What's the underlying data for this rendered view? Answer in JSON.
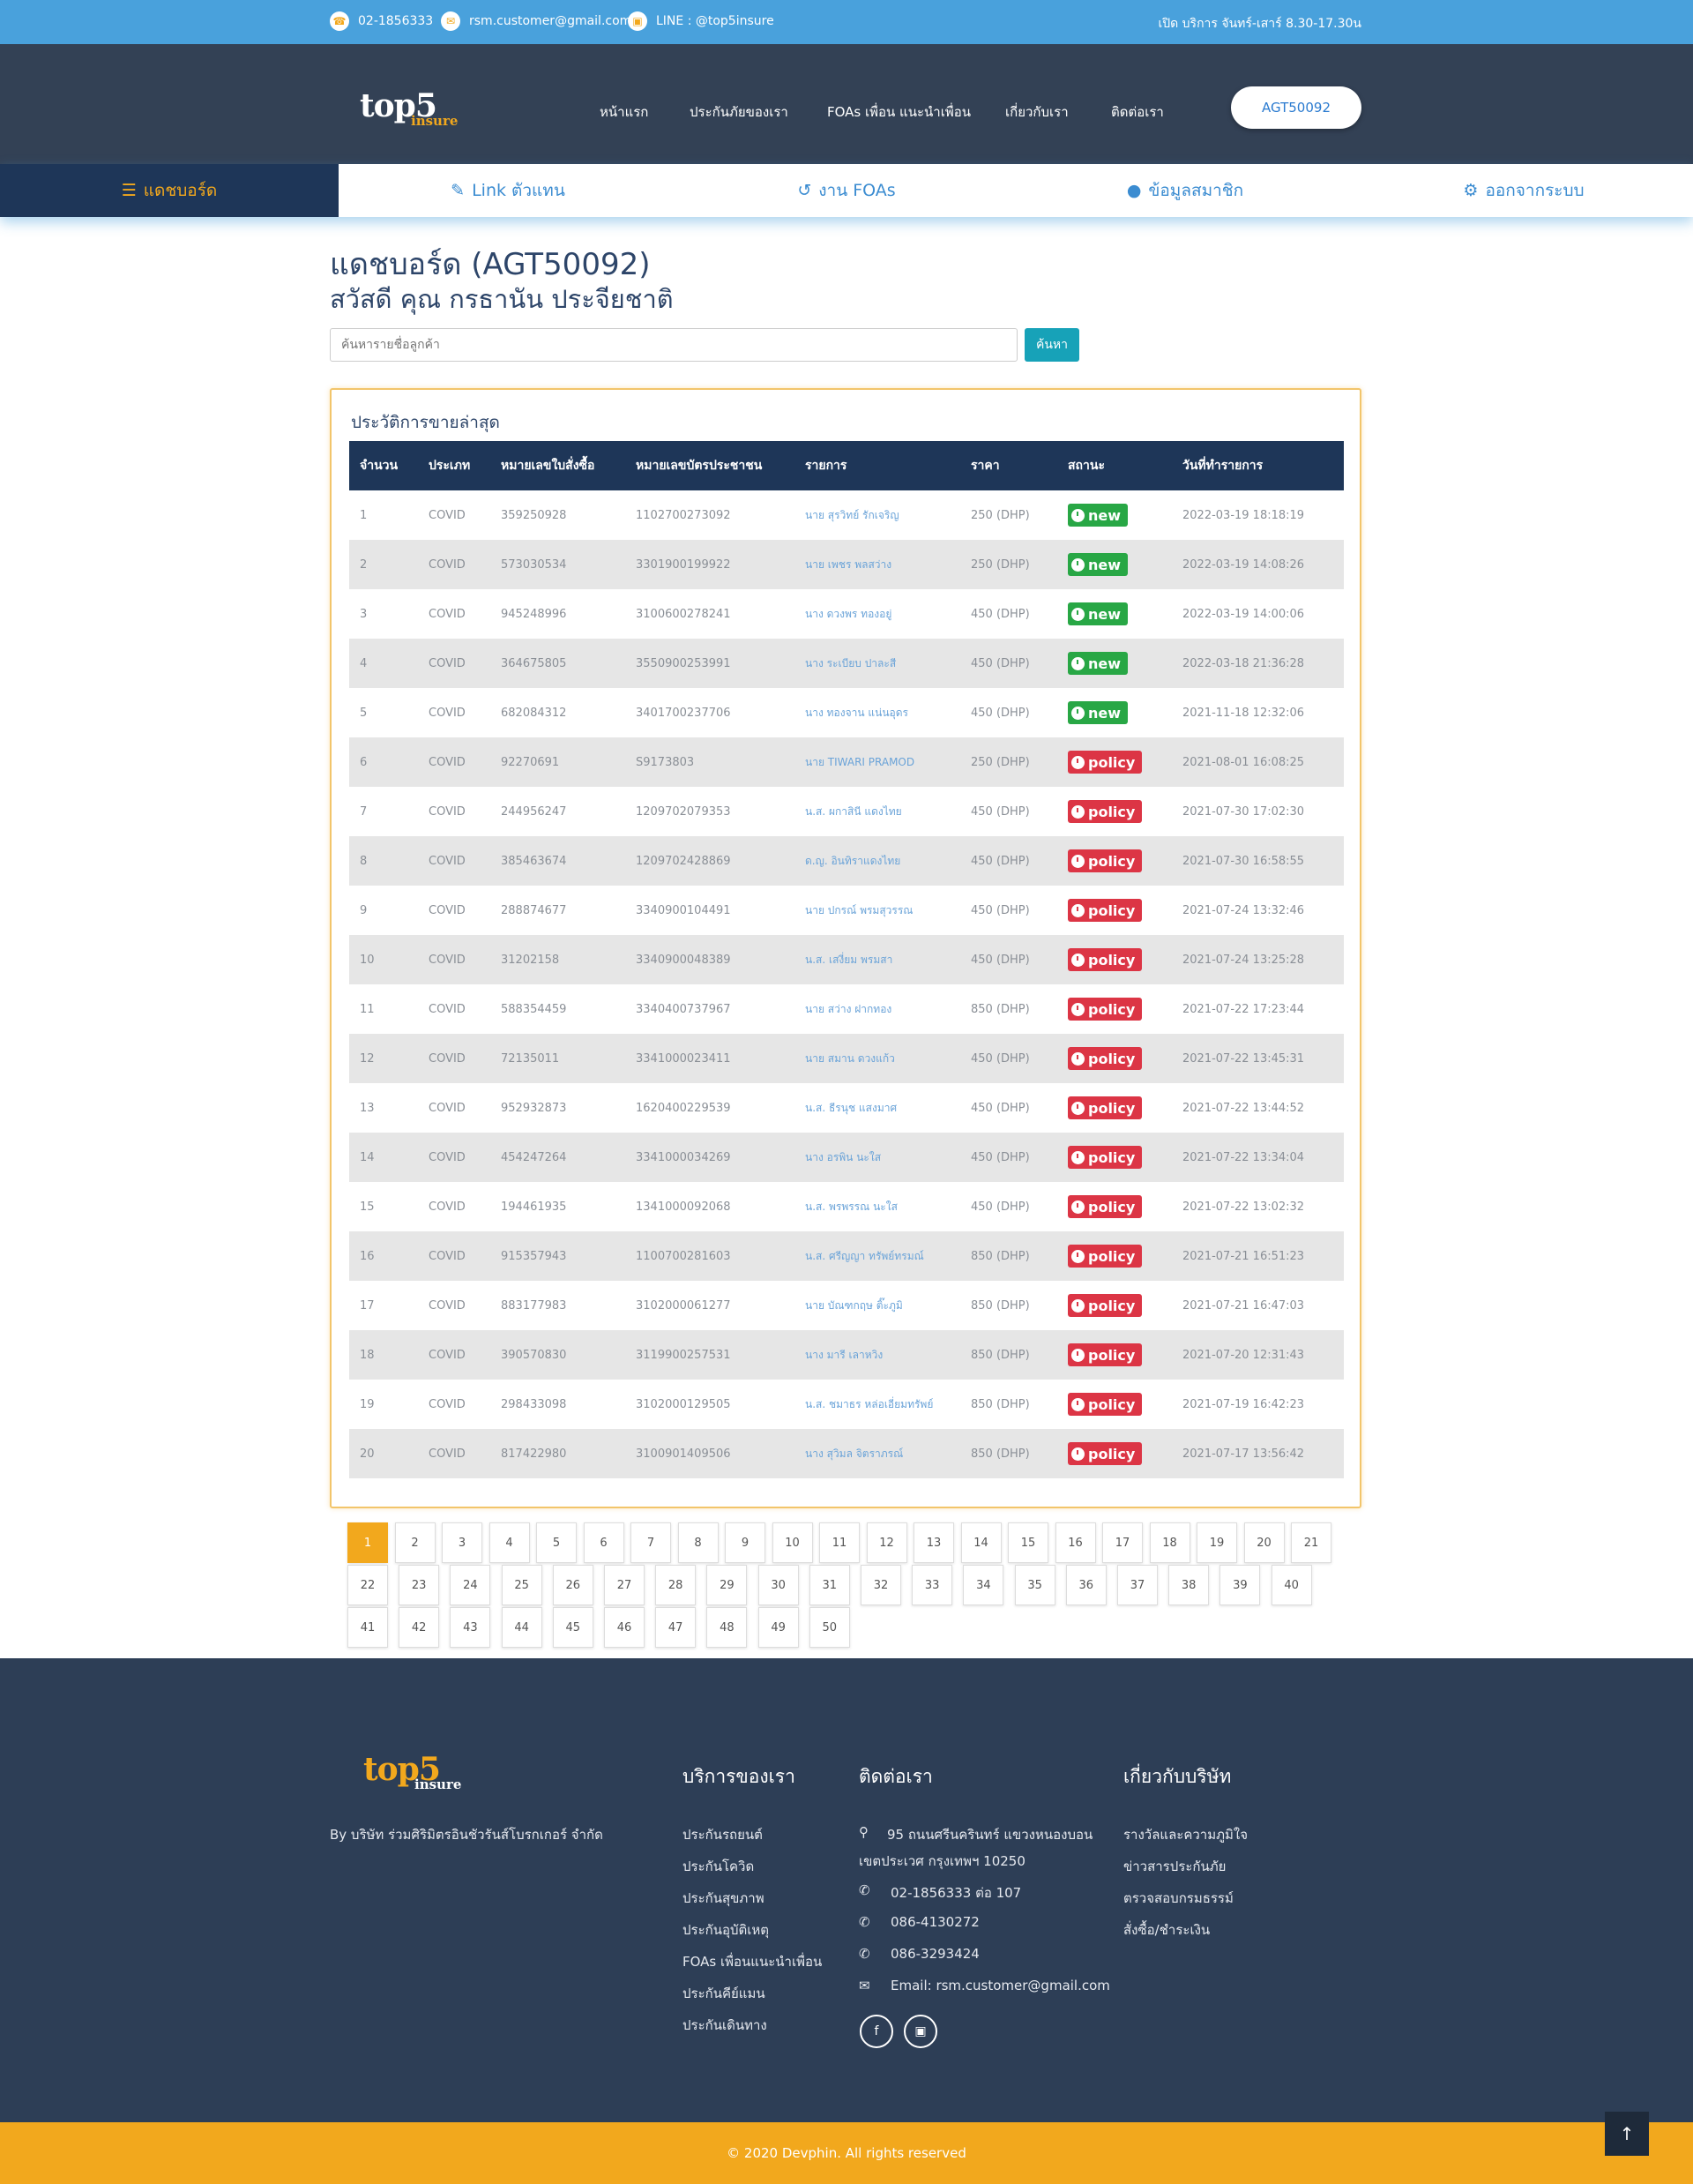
{
  "topbar": {
    "phone": "02-1856333",
    "email": "rsm.customer@gmail.com",
    "line": "LINE : @top5insure",
    "hours": "เปิด บริการ จันทร์-เสาร์ 8.30-17.30น"
  },
  "logo": {
    "text": "top5",
    "sub": "insure"
  },
  "nav": [
    "หน้าแรก",
    "ประกันภัยของเรา",
    "FOAs เพื่อน แนะนำเพื่อน",
    "เกี่ยวกับเรา",
    "ติดต่อเรา"
  ],
  "agent_button": "AGT50092",
  "tabs": [
    {
      "label": "แดชบอร์ด",
      "icon": "list-icon"
    },
    {
      "label": "Link ตัวแทน",
      "icon": "edit-icon"
    },
    {
      "label": "งาน FOAs",
      "icon": "history-icon"
    },
    {
      "label": "ข้อมูลสมาชิก",
      "icon": "user-icon"
    },
    {
      "label": "ออกจากระบบ",
      "icon": "gear-icon"
    }
  ],
  "page": {
    "title": "แดชบอร์ด (AGT50092)",
    "greeting": "สวัสดี คุณ กรธานัน ประจียชาติ",
    "search_placeholder": "ค้นหารายชื่อลูกค้า",
    "search_button": "ค้นหา"
  },
  "sales": {
    "title": "ประวัติการขายล่าสุด",
    "columns": [
      "จำนวน",
      "ประเภท",
      "หมายเลขใบสั่งซื้อ",
      "หมายเลขบัตรประชาชน",
      "รายการ",
      "ราคา",
      "สถานะ",
      "วันที่ทำรายการ"
    ],
    "rows": [
      [
        "1",
        "COVID",
        "359250928",
        "1102700273092",
        "นาย สุรวิทย์ รักเจริญ",
        "250 (DHP)",
        "new",
        "2022-03-19 18:18:19"
      ],
      [
        "2",
        "COVID",
        "573030534",
        "3301900199922",
        "นาย เพชร พลสว่าง",
        "250 (DHP)",
        "new",
        "2022-03-19 14:08:26"
      ],
      [
        "3",
        "COVID",
        "945248996",
        "3100600278241",
        "นาง ดวงพร ทองอยู่",
        "450 (DHP)",
        "new",
        "2022-03-19 14:00:06"
      ],
      [
        "4",
        "COVID",
        "364675805",
        "3550900253991",
        "นาง ระเบียบ ปาละสี",
        "450 (DHP)",
        "new",
        "2022-03-18 21:36:28"
      ],
      [
        "5",
        "COVID",
        "682084312",
        "3401700237706",
        "นาง ทองจาน แน่นอุดร",
        "450 (DHP)",
        "new",
        "2021-11-18 12:32:06"
      ],
      [
        "6",
        "COVID",
        "92270691",
        "S9173803",
        "นาย TIWARI PRAMOD",
        "250 (DHP)",
        "policy",
        "2021-08-01 16:08:25"
      ],
      [
        "7",
        "COVID",
        "244956247",
        "1209702079353",
        "น.ส. ผกาสินี แดงไทย",
        "450 (DHP)",
        "policy",
        "2021-07-30 17:02:30"
      ],
      [
        "8",
        "COVID",
        "385463674",
        "1209702428869",
        "ด.ญ. อินทิราแดงไทย",
        "450 (DHP)",
        "policy",
        "2021-07-30 16:58:55"
      ],
      [
        "9",
        "COVID",
        "288874677",
        "3340900104491",
        "นาย ปกรณ์ พรมสุวรรณ",
        "450 (DHP)",
        "policy",
        "2021-07-24 13:32:46"
      ],
      [
        "10",
        "COVID",
        "31202158",
        "3340900048389",
        "น.ส. เสงี่ยม พรมสา",
        "450 (DHP)",
        "policy",
        "2021-07-24 13:25:28"
      ],
      [
        "11",
        "COVID",
        "588354459",
        "3340400737967",
        "นาย สว่าง ฝากทอง",
        "850 (DHP)",
        "policy",
        "2021-07-22 17:23:44"
      ],
      [
        "12",
        "COVID",
        "72135011",
        "3341000023411",
        "นาย สมาน ดวงแก้ว",
        "450 (DHP)",
        "policy",
        "2021-07-22 13:45:31"
      ],
      [
        "13",
        "COVID",
        "952932873",
        "1620400229539",
        "น.ส. ธีรนุช แสงมาศ",
        "450 (DHP)",
        "policy",
        "2021-07-22 13:44:52"
      ],
      [
        "14",
        "COVID",
        "454247264",
        "3341000034269",
        "นาง อรพิน นะใส",
        "450 (DHP)",
        "policy",
        "2021-07-22 13:34:04"
      ],
      [
        "15",
        "COVID",
        "194461935",
        "1341000092068",
        "น.ส. พรพรรณ นะใส",
        "450 (DHP)",
        "policy",
        "2021-07-22 13:02:32"
      ],
      [
        "16",
        "COVID",
        "915357943",
        "1100700281603",
        "น.ส. ศรีญญา ทรัพย์ทรมณ์",
        "850 (DHP)",
        "policy",
        "2021-07-21 16:51:23"
      ],
      [
        "17",
        "COVID",
        "883177983",
        "3102000061277",
        "นาย บัณฑกฤษ ติ๊ะภูมิ",
        "850 (DHP)",
        "policy",
        "2021-07-21 16:47:03"
      ],
      [
        "18",
        "COVID",
        "390570830",
        "3119900257531",
        "นาง มารี เลาหวิง",
        "850 (DHP)",
        "policy",
        "2021-07-20 12:31:43"
      ],
      [
        "19",
        "COVID",
        "298433098",
        "3102000129505",
        "น.ส. ชมาธร หล่อเอี่ยมทรัพย์",
        "850 (DHP)",
        "policy",
        "2021-07-19 16:42:23"
      ],
      [
        "20",
        "COVID",
        "817422980",
        "3100901409506",
        "นาง สุวิมล จิตราภรณ์",
        "850 (DHP)",
        "policy",
        "2021-07-17 13:56:42"
      ]
    ]
  },
  "pagination": {
    "current": 1,
    "pages": [
      "1",
      "2",
      "3",
      "4",
      "5",
      "6",
      "7",
      "8",
      "9",
      "10",
      "11",
      "12",
      "13",
      "14",
      "15",
      "16",
      "17",
      "18",
      "19",
      "20",
      "21",
      "22",
      "23",
      "24",
      "25",
      "26",
      "27",
      "28",
      "29",
      "30",
      "31",
      "32",
      "33",
      "34",
      "35",
      "36",
      "37",
      "38",
      "39",
      "40",
      "41",
      "42",
      "43",
      "44",
      "45",
      "46",
      "47",
      "48",
      "49",
      "50"
    ]
  },
  "footer": {
    "company": "By บริษัท ร่วมศิริมิตรอินชัวรันส์โบรกเกอร์ จำกัด",
    "services_title": "บริการของเรา",
    "services": [
      "ประกันรถยนต์",
      "ประกันโควิด",
      "ประกันสุขภาพ",
      "ประกันอุบัติเหตุ",
      "FOAs เพื่อนแนะนำเพื่อน",
      "ประกันคีย์แมน",
      "ประกันเดินทาง"
    ],
    "contact_title": "ติดต่อเรา",
    "address1": "95 ถนนศรีนครินทร์ แขวงหนองบอน",
    "address2": "เขตประเวศ กรุงเทพฯ 10250",
    "phones": [
      "02-1856333 ต่อ 107",
      "086-4130272",
      "086-3293424"
    ],
    "email": "Email: rsm.customer@gmail.com",
    "about_title": "เกี่ยวกับบริษัท",
    "about": [
      "รางวัลและความภูมิใจ",
      "ข่าวสารประกันภัย",
      "ตรวจสอบกรมธรรม์",
      "สั่งซื้อ/ชำระเงิน"
    ],
    "copyright": "© 2020 Devphin. All rights reserved"
  },
  "colors": {
    "topbar": "#49a1dc",
    "header": "#334155",
    "accent": "#f2a81d",
    "new": "#28a745",
    "policy": "#dc3545"
  }
}
